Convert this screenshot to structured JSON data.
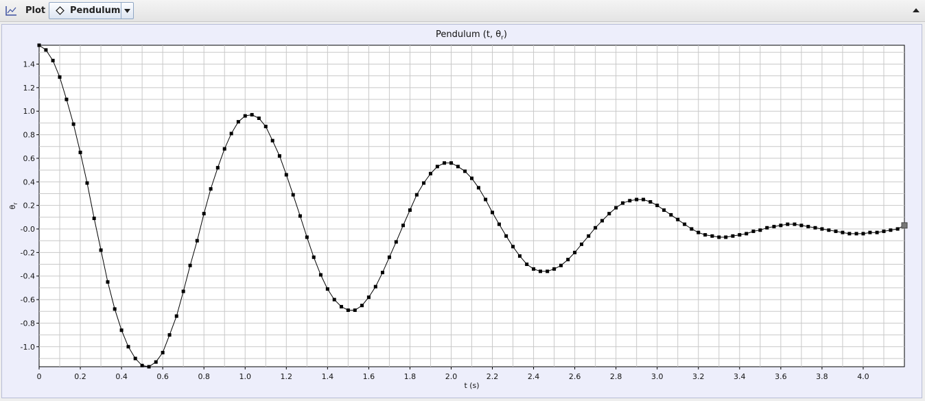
{
  "toolbar": {
    "plot_label": "Plot",
    "selected_plot": "Pendulum",
    "plot_icon": "plot-axes-icon",
    "diamond_icon": "diamond-icon",
    "dropdown_icon": "chevron-down-icon",
    "collapse_icon": "collapse-up-icon"
  },
  "chart_data": {
    "type": "line",
    "title": "Pendulum (t, θr)",
    "title_main": "Pendulum (t, θ",
    "title_sub": "r",
    "title_end": ")",
    "xlabel": "t (s)",
    "ylabel": "θ",
    "ylabel_sub": "r",
    "xlim": [
      0,
      4.2
    ],
    "ylim": [
      -1.17,
      1.56
    ],
    "grid": true,
    "legend": false,
    "series_color": "#000000",
    "marker": "square",
    "x_ticks": [
      "0",
      "0.2",
      "0.4",
      "0.6",
      "0.8",
      "1.0",
      "1.2",
      "1.4",
      "1.6",
      "1.8",
      "2.0",
      "2.2",
      "2.4",
      "2.6",
      "2.8",
      "3.0",
      "3.2",
      "3.4",
      "3.6",
      "3.8",
      "4.0"
    ],
    "y_ticks": [
      "1.4",
      "1.2",
      "1.0",
      "0.8",
      "0.6",
      "0.4",
      "0.2",
      "-0.0",
      "-0.2",
      "-0.4",
      "-0.6",
      "-0.8",
      "-1.0"
    ],
    "x_tick_values": [
      0,
      0.2,
      0.4,
      0.6,
      0.8,
      1.0,
      1.2,
      1.4,
      1.6,
      1.8,
      2.0,
      2.2,
      2.4,
      2.6,
      2.8,
      3.0,
      3.2,
      3.4,
      3.6,
      3.8,
      4.0
    ],
    "y_tick_values": [
      1.4,
      1.2,
      1.0,
      0.8,
      0.6,
      0.4,
      0.2,
      0.0,
      -0.2,
      -0.4,
      -0.6,
      -0.8,
      -1.0
    ],
    "series": [
      {
        "x": [
          0.0,
          0.033,
          0.067,
          0.1,
          0.133,
          0.167,
          0.2,
          0.233,
          0.267,
          0.3,
          0.333,
          0.367,
          0.4,
          0.433,
          0.467,
          0.5,
          0.533,
          0.567,
          0.6,
          0.633,
          0.667,
          0.7,
          0.733,
          0.767,
          0.8,
          0.833,
          0.867,
          0.9,
          0.933,
          0.967,
          1.0,
          1.033,
          1.067,
          1.1,
          1.133,
          1.167,
          1.2,
          1.233,
          1.267,
          1.3,
          1.333,
          1.367,
          1.4,
          1.433,
          1.467,
          1.5,
          1.533,
          1.567,
          1.6,
          1.633,
          1.667,
          1.7,
          1.733,
          1.767,
          1.8,
          1.833,
          1.867,
          1.9,
          1.933,
          1.967,
          2.0,
          2.033,
          2.067,
          2.1,
          2.133,
          2.167,
          2.2,
          2.233,
          2.267,
          2.3,
          2.333,
          2.367,
          2.4,
          2.433,
          2.467,
          2.5,
          2.533,
          2.567,
          2.6,
          2.633,
          2.667,
          2.7,
          2.733,
          2.767,
          2.8,
          2.833,
          2.867,
          2.9,
          2.933,
          2.967,
          3.0,
          3.033,
          3.067,
          3.1,
          3.133,
          3.167,
          3.2,
          3.233,
          3.267,
          3.3,
          3.333,
          3.367,
          3.4,
          3.433,
          3.467,
          3.5,
          3.533,
          3.567,
          3.6,
          3.633,
          3.667,
          3.7,
          3.733,
          3.767,
          3.8,
          3.833,
          3.867,
          3.9,
          3.933,
          3.967,
          4.0,
          4.033,
          4.067,
          4.1,
          4.133,
          4.167,
          4.2
        ],
        "y": [
          1.56,
          1.52,
          1.43,
          1.29,
          1.1,
          0.89,
          0.65,
          0.39,
          0.09,
          -0.18,
          -0.45,
          -0.68,
          -0.86,
          -1.0,
          -1.1,
          -1.16,
          -1.17,
          -1.13,
          -1.05,
          -0.9,
          -0.74,
          -0.53,
          -0.31,
          -0.1,
          0.13,
          0.34,
          0.52,
          0.68,
          0.81,
          0.91,
          0.96,
          0.97,
          0.94,
          0.87,
          0.75,
          0.62,
          0.46,
          0.29,
          0.11,
          -0.07,
          -0.24,
          -0.39,
          -0.51,
          -0.6,
          -0.66,
          -0.69,
          -0.69,
          -0.65,
          -0.58,
          -0.49,
          -0.37,
          -0.24,
          -0.11,
          0.03,
          0.16,
          0.29,
          0.39,
          0.47,
          0.53,
          0.56,
          0.56,
          0.53,
          0.49,
          0.43,
          0.35,
          0.25,
          0.14,
          0.04,
          -0.06,
          -0.15,
          -0.23,
          -0.3,
          -0.34,
          -0.36,
          -0.36,
          -0.34,
          -0.31,
          -0.26,
          -0.2,
          -0.13,
          -0.06,
          0.01,
          0.07,
          0.13,
          0.18,
          0.22,
          0.24,
          0.25,
          0.25,
          0.23,
          0.2,
          0.16,
          0.12,
          0.08,
          0.04,
          0.0,
          -0.03,
          -0.05,
          -0.06,
          -0.07,
          -0.07,
          -0.06,
          -0.05,
          -0.04,
          -0.02,
          -0.01,
          0.01,
          0.02,
          0.03,
          0.04,
          0.04,
          0.03,
          0.02,
          0.01,
          0.0,
          -0.01,
          -0.02,
          -0.03,
          -0.04,
          -0.04,
          -0.04,
          -0.03,
          -0.03,
          -0.02,
          -0.01,
          0.0,
          0.03
        ]
      }
    ]
  }
}
